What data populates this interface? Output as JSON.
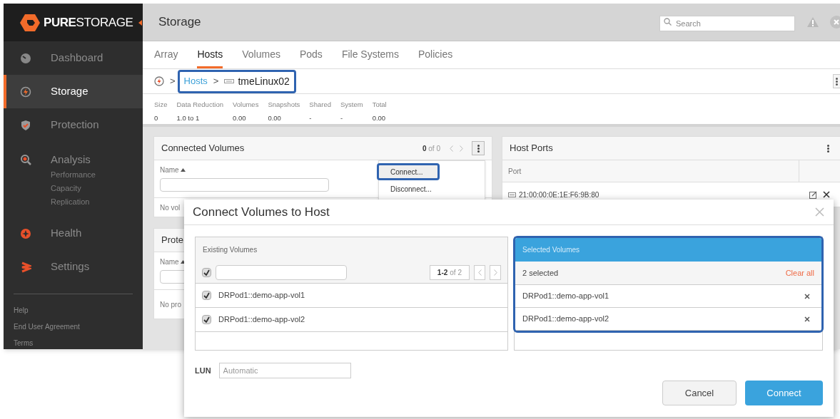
{
  "sidebar": {
    "logo": "**PURE**STORAGE",
    "items": [
      {
        "label": "Dashboard",
        "selected": false
      },
      {
        "label": "Storage",
        "selected": true
      },
      {
        "label": "Protection",
        "selected": false
      },
      {
        "label": "Analysis",
        "selected": false,
        "children": [
          {
            "label": "Performance"
          },
          {
            "label": "Capacity"
          },
          {
            "label": "Replication"
          }
        ]
      },
      {
        "label": "Health",
        "selected": false
      },
      {
        "label": "Settings",
        "selected": false
      }
    ],
    "footer_links": [
      "Help",
      "End User Agreement",
      "Terms"
    ]
  },
  "header": {
    "title": "Storage",
    "search": {
      "placeholder": "Search"
    }
  },
  "tabs": [
    {
      "label": "Array",
      "selected": false
    },
    {
      "label": "Hosts",
      "selected": true
    },
    {
      "label": "Volumes",
      "selected": false
    },
    {
      "label": "Pods",
      "selected": false
    },
    {
      "label": "File Systems",
      "selected": false
    },
    {
      "label": "Policies",
      "selected": false
    }
  ],
  "breadcrumb": [
    {
      "kind": "home"
    },
    {
      "kind": "separator",
      "text": ">"
    },
    {
      "kind": "link",
      "text": "Hosts"
    },
    {
      "kind": "separator",
      "text": ">"
    },
    {
      "kind": "host",
      "text": "tmeLinux02"
    }
  ],
  "stats": [
    {
      "label": "Size",
      "value": "0"
    },
    {
      "label": "Data Reduction",
      "value": "1.0 to 1"
    },
    {
      "label": "Volumes",
      "value": "0.00"
    },
    {
      "label": "Snapshots",
      "value": "0.00"
    },
    {
      "label": "Shared",
      "value": "-"
    },
    {
      "label": "System",
      "value": "-"
    },
    {
      "label": "Total",
      "value": "0.00"
    }
  ],
  "connected_volumes": {
    "title": "Connected Volumes",
    "pager_current": "0",
    "pager_total": "of 0",
    "column": "Name",
    "empty_text": "No vol",
    "menu": [
      {
        "label": "Connect...",
        "selected": true
      },
      {
        "label": "Disconnect...",
        "selected": false
      }
    ]
  },
  "protection": {
    "title": "Prote",
    "column": "Name",
    "empty_text": "No pro"
  },
  "host_ports": {
    "title": "Host Ports",
    "column": "Port",
    "rows": [
      {
        "port": "21:00:00:0E:1E:F6:9B:80"
      }
    ]
  },
  "dialog": {
    "title": "Connect Volumes to Host",
    "existing": {
      "title": "Existing Volumes",
      "select_all_checked": true,
      "pager_range": "1-2",
      "pager_total": "of 2",
      "rows": [
        {
          "name": "DRPod1::demo-app-vol1",
          "checked": true
        },
        {
          "name": "DRPod1::demo-app-vol2",
          "checked": true
        }
      ]
    },
    "selected_panel": {
      "title": "Selected Volumes",
      "count": "2 selected",
      "clear": "Clear all",
      "rows": [
        {
          "name": "DRPod1::demo-app-vol1"
        },
        {
          "name": "DRPod1::demo-app-vol2"
        }
      ]
    },
    "lun": {
      "label": "LUN",
      "placeholder": "Automatic"
    },
    "buttons": [
      {
        "label": "Cancel",
        "kind": "secondary"
      },
      {
        "label": "Connect",
        "kind": "primary"
      }
    ]
  }
}
